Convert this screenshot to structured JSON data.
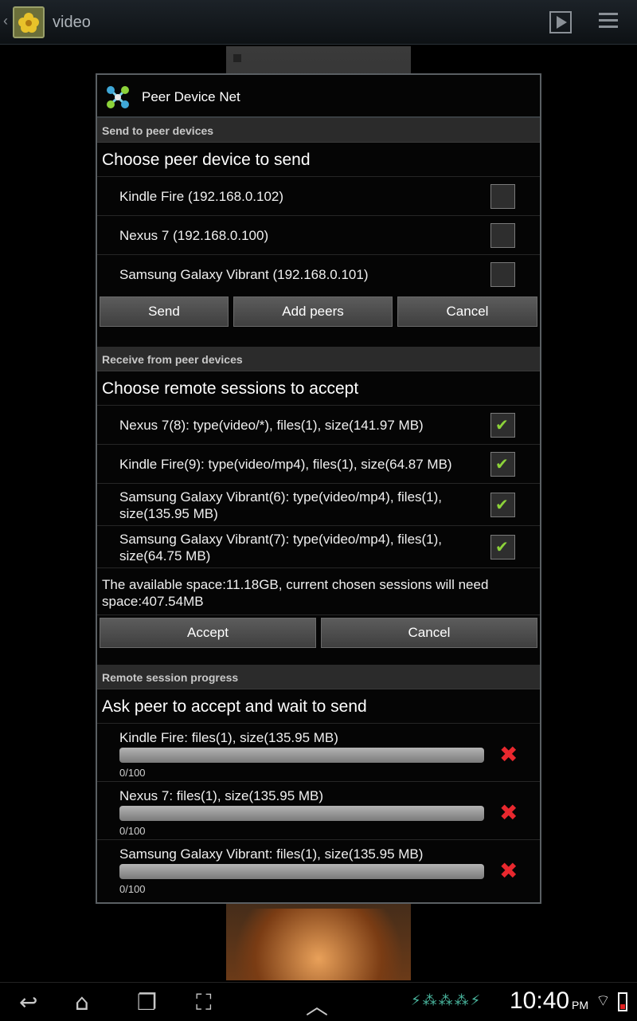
{
  "action_bar": {
    "title": "video"
  },
  "dialog": {
    "title": "Peer Device Net",
    "send_section": {
      "header": "Send to peer devices",
      "prompt": "Choose peer device to send",
      "devices": [
        {
          "label": "Kindle Fire (192.168.0.102)",
          "checked": false
        },
        {
          "label": "Nexus 7 (192.168.0.100)",
          "checked": false
        },
        {
          "label": "Samsung Galaxy Vibrant (192.168.0.101)",
          "checked": false
        }
      ],
      "buttons": {
        "send": "Send",
        "add_peers": "Add peers",
        "cancel": "Cancel"
      }
    },
    "receive_section": {
      "header": "Receive from peer devices",
      "prompt": "Choose remote sessions to accept",
      "sessions": [
        {
          "label": "Nexus 7(8): type(video/*), files(1), size(141.97 MB)",
          "checked": true
        },
        {
          "label": "Kindle Fire(9): type(video/mp4), files(1), size(64.87 MB)",
          "checked": true
        },
        {
          "label": "Samsung Galaxy Vibrant(6): type(video/mp4), files(1), size(135.95 MB)",
          "checked": true
        },
        {
          "label": "Samsung Galaxy Vibrant(7): type(video/mp4), files(1), size(64.75 MB)",
          "checked": true
        }
      ],
      "space_text": "The available space:11.18GB, current chosen sessions will need space:407.54MB",
      "buttons": {
        "accept": "Accept",
        "cancel": "Cancel"
      }
    },
    "progress_section": {
      "header": "Remote session progress",
      "prompt": "Ask peer to accept and wait to send",
      "items": [
        {
          "label": "Kindle Fire: files(1), size(135.95 MB)",
          "progress_text": "0/100",
          "progress": 0
        },
        {
          "label": "Nexus 7: files(1), size(135.95 MB)",
          "progress_text": "0/100",
          "progress": 0
        },
        {
          "label": "Samsung Galaxy Vibrant: files(1), size(135.95 MB)",
          "progress_text": "0/100",
          "progress": 0
        }
      ]
    }
  },
  "system_bar": {
    "time": "10:40",
    "ampm": "PM"
  },
  "icons": {
    "cancel_icon": "red-x-icon",
    "check_color": "#8cd23a",
    "cancel_color": "#e8282e"
  }
}
